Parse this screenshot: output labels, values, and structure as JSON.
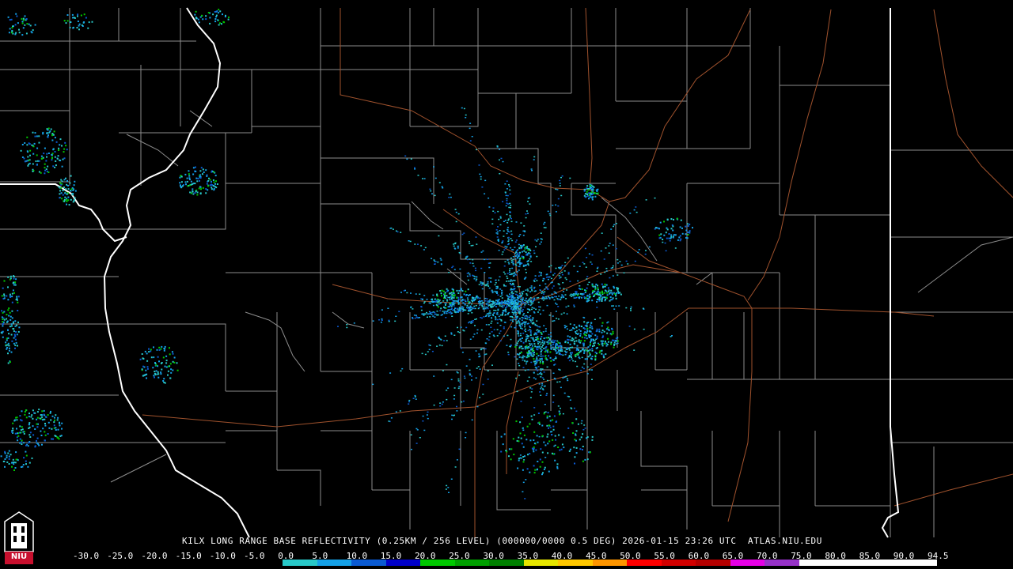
{
  "caption": "KILX LONG RANGE BASE REFLECTIVITY (0.25KM / 256 LEVEL) (000000/0000 0.5 DEG) 2026-01-15 23:26 UTC  ATLAS.NIU.EDU",
  "logo": {
    "text": "NIU",
    "icon": "niu-tower-icon"
  },
  "scale": {
    "labels": [
      "-30.0",
      "-25.0",
      "-20.0",
      "-15.0",
      "-10.0",
      "-5.0",
      "0.0",
      "5.0",
      "10.0",
      "15.0",
      "20.0",
      "25.0",
      "30.0",
      "35.0",
      "40.0",
      "45.0",
      "50.0",
      "55.0",
      "60.0",
      "65.0",
      "70.0",
      "75.0",
      "80.0",
      "85.0",
      "90.0",
      "94.5"
    ],
    "colors": [
      "#000000",
      "#000000",
      "#000000",
      "#000000",
      "#000000",
      "#000000",
      "#28c8c8",
      "#14a0e6",
      "#0a5ad2",
      "#0000c8",
      "#00c800",
      "#00a000",
      "#008000",
      "#e6e600",
      "#ffc800",
      "#ff9600",
      "#ff0000",
      "#d20000",
      "#b40000",
      "#e600e6",
      "#9632c8",
      "#ffffff",
      "#ffffff",
      "#ffffff",
      "#ffffff"
    ]
  },
  "map_colors": {
    "background": "#000000",
    "county_lines": "#8c8c8c",
    "state_lines": "#ffffff",
    "highways": "#a0522d"
  }
}
